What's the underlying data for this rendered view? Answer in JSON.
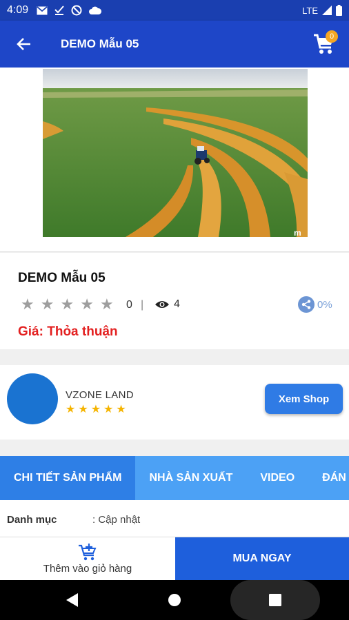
{
  "status_bar": {
    "time": "4:09",
    "network": "LTE",
    "left_icons": [
      "gmail-icon",
      "download-done-icon",
      "no-sim-icon",
      "cloud-icon"
    ],
    "right_icons": [
      "signal-icon",
      "battery-icon"
    ]
  },
  "app_bar": {
    "title": "DEMO Mẫu 05",
    "cart_count": "0",
    "color": "#1e46c8"
  },
  "product": {
    "name": "DEMO Mẫu 05",
    "rating_value": "0",
    "rating_max": 5,
    "separator": "|",
    "views": "4",
    "share_percent": "0%",
    "price_label": "Giá: Thỏa thuận",
    "price_color": "#e32020"
  },
  "shop": {
    "name": "VZONE LAND",
    "stars": 5,
    "button_label": "Xem Shop",
    "star_color": "#f5b400"
  },
  "tabs": [
    {
      "label": "CHI TIẾT SẢN PHẨM",
      "active": true
    },
    {
      "label": "NHÀ SẢN XUẤT",
      "active": false
    },
    {
      "label": "VIDEO",
      "active": false
    },
    {
      "label": "ĐÁN",
      "active": false
    }
  ],
  "details": {
    "label": "Danh mục",
    "value": ": Cập nhật"
  },
  "bottom_actions": {
    "add_to_cart": "Thêm vào giỏ hàng",
    "buy_now": "MUA NGAY"
  },
  "nav_bar": {
    "buttons": [
      "back-icon",
      "home-icon",
      "recents-icon"
    ]
  }
}
